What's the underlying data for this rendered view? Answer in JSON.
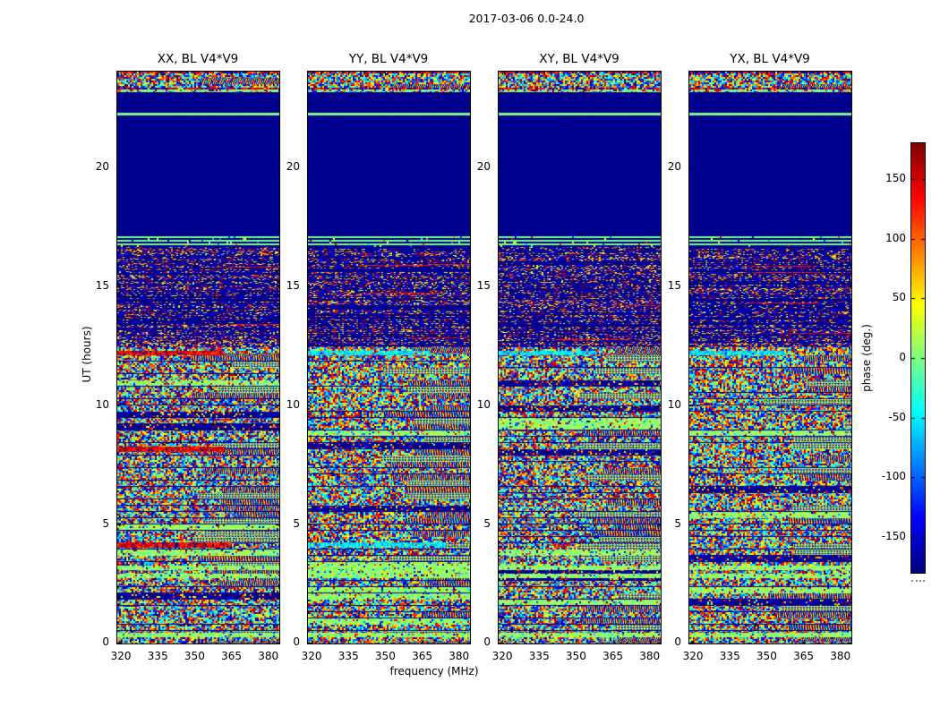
{
  "figure": {
    "title": "2017-03-06 0.0-24.0",
    "xlabel": "frequency (MHz)",
    "ylabel": "UT (hours)",
    "colorbar_label": "phase (deg.)",
    "background": "#ffffff",
    "frame_color": "#000000"
  },
  "chart_data": {
    "type": "heatmap",
    "title": "2017-03-06 0.0-24.0",
    "xlabel": "frequency (MHz)",
    "ylabel": "UT (hours)",
    "x_range": [
      318.5,
      384.5
    ],
    "x_ticks": [
      320,
      335,
      350,
      365,
      380
    ],
    "y_range": [
      0,
      24
    ],
    "y_ticks": [
      0,
      5,
      10,
      15,
      20
    ],
    "colorbar": {
      "label": "phase (deg.)",
      "range": [
        -180,
        180
      ],
      "ticks": [
        150,
        100,
        50,
        0,
        -50,
        -100,
        -150
      ],
      "colormap": "jet"
    },
    "panels": [
      {
        "title": "XX, BL V4*V9",
        "seed": 101,
        "specials": [
          {
            "from": 12.28,
            "to": 12.08,
            "tint": "red",
            "xfrac": 0.66
          },
          {
            "from": 8.25,
            "to": 8.02,
            "tint": "red",
            "xfrac": 0.66
          },
          {
            "from": 4.24,
            "to": 4.02,
            "tint": "red",
            "xfrac": 0.7
          }
        ]
      },
      {
        "title": "YY, BL V4*V9",
        "seed": 202,
        "specials": [
          {
            "from": 12.28,
            "to": 12.08,
            "tint": "cyan",
            "xfrac": 0.75
          },
          {
            "from": 4.24,
            "to": 4.02,
            "tint": "cyan",
            "xfrac": 0.85
          }
        ]
      },
      {
        "title": "XY, BL V4*V9",
        "seed": 303,
        "specials": [
          {
            "from": 12.28,
            "to": 12.08,
            "tint": "cyan",
            "xfrac": 0.6
          }
        ]
      },
      {
        "title": "YX, BL V4*V9",
        "seed": 404,
        "specials": [
          {
            "from": 12.28,
            "to": 12.08,
            "tint": "cyan",
            "xfrac": 0.6
          }
        ]
      }
    ],
    "shared_specials": [
      {
        "from": 3.27,
        "to": 3.08,
        "tint": "green",
        "xfrac": 1.0
      },
      {
        "from": 2.93,
        "to": 2.74,
        "tint": "green",
        "xfrac": 1.0
      },
      {
        "from": 0.45,
        "to": 0.26,
        "tint": "green",
        "xfrac": 1.0
      }
    ],
    "bands": [
      {
        "from": 24.0,
        "to": 23.93,
        "type": "red-speckle"
      },
      {
        "from": 23.93,
        "to": 23.32,
        "type": "dense"
      },
      {
        "from": 23.32,
        "to": 23.24,
        "type": "red-speckle"
      },
      {
        "from": 23.24,
        "to": 23.12,
        "type": "green-speckle"
      },
      {
        "from": 23.12,
        "to": 22.26,
        "type": "solid"
      },
      {
        "from": 22.26,
        "to": 22.15,
        "type": "green"
      },
      {
        "from": 22.15,
        "to": 17.1,
        "type": "solid"
      },
      {
        "from": 17.1,
        "to": 16.65,
        "type": "green-stripes"
      },
      {
        "from": 16.65,
        "to": 12.45,
        "type": "sparse-stripes"
      },
      {
        "from": 12.45,
        "to": 12.08,
        "type": "dense"
      },
      {
        "from": 12.08,
        "to": 0.26,
        "type": "dense-blocks"
      },
      {
        "from": 0.26,
        "to": 0.0,
        "type": "dense"
      }
    ]
  }
}
